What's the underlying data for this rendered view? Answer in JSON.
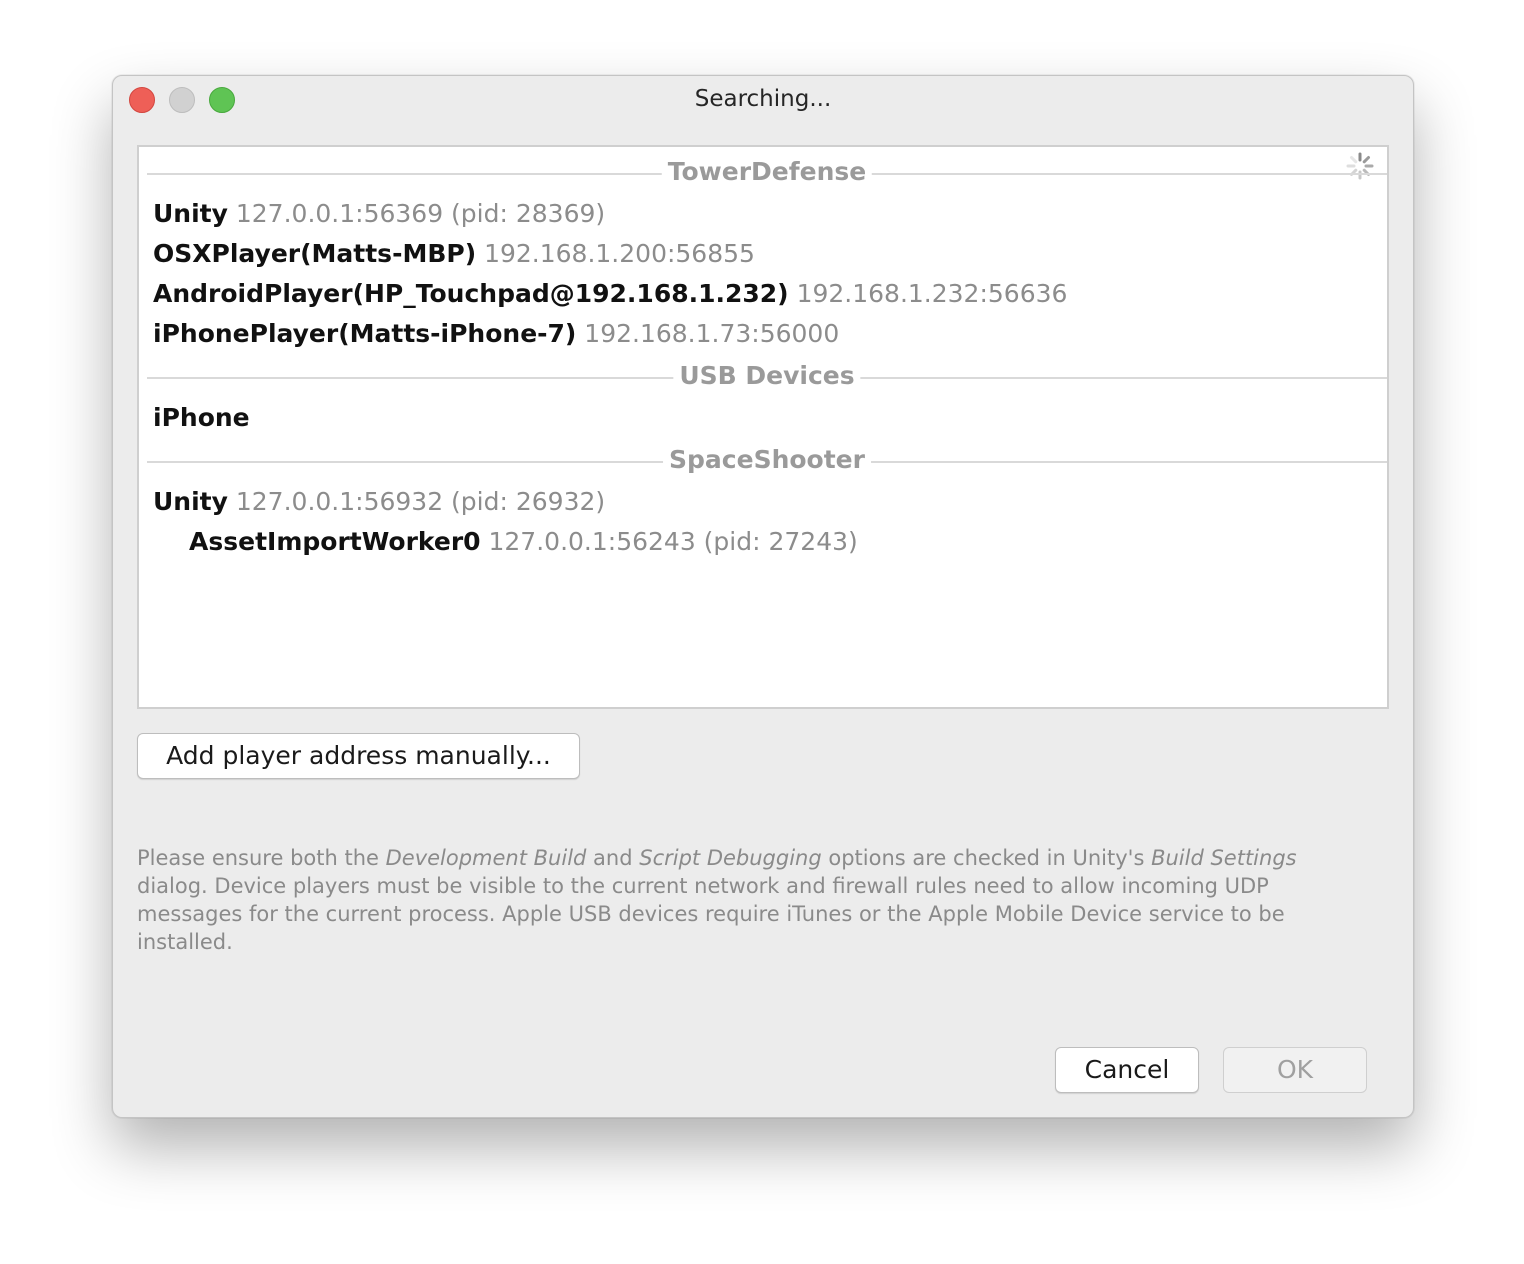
{
  "window": {
    "title": "Searching..."
  },
  "groups": [
    {
      "header": "TowerDefense",
      "entries": [
        {
          "name": "Unity",
          "address": "127.0.0.1:56369 (pid: 28369)"
        },
        {
          "name": "OSXPlayer(Matts-MBP)",
          "address": "192.168.1.200:56855"
        },
        {
          "name": "AndroidPlayer(HP_Touchpad@192.168.1.232)",
          "address": "192.168.1.232:56636"
        },
        {
          "name": "iPhonePlayer(Matts-iPhone-7)",
          "address": "192.168.1.73:56000"
        }
      ]
    },
    {
      "header": "USB Devices",
      "entries": [
        {
          "name": "iPhone",
          "address": ""
        }
      ]
    },
    {
      "header": "SpaceShooter",
      "entries": [
        {
          "name": "Unity",
          "address": "127.0.0.1:56932 (pid: 26932)"
        },
        {
          "name": "AssetImportWorker0",
          "address": "127.0.0.1:56243 (pid: 27243)"
        }
      ]
    }
  ],
  "buttons": {
    "add_manually": "Add player address manually...",
    "cancel": "Cancel",
    "ok": "OK"
  },
  "help": {
    "t1": "Please ensure both the ",
    "i1": "Development Build",
    "t2": " and ",
    "i2": "Script Debugging",
    "t3": " options are checked in Unity's ",
    "i3": "Build Settings",
    "t4": " dialog. Device players must be visible to the current network and firewall rules need to allow incoming UDP messages for the current process. Apple USB devices require iTunes or the Apple Mobile Device service to be installed."
  },
  "icons": {
    "spinner": "loading-spinner-icon"
  }
}
